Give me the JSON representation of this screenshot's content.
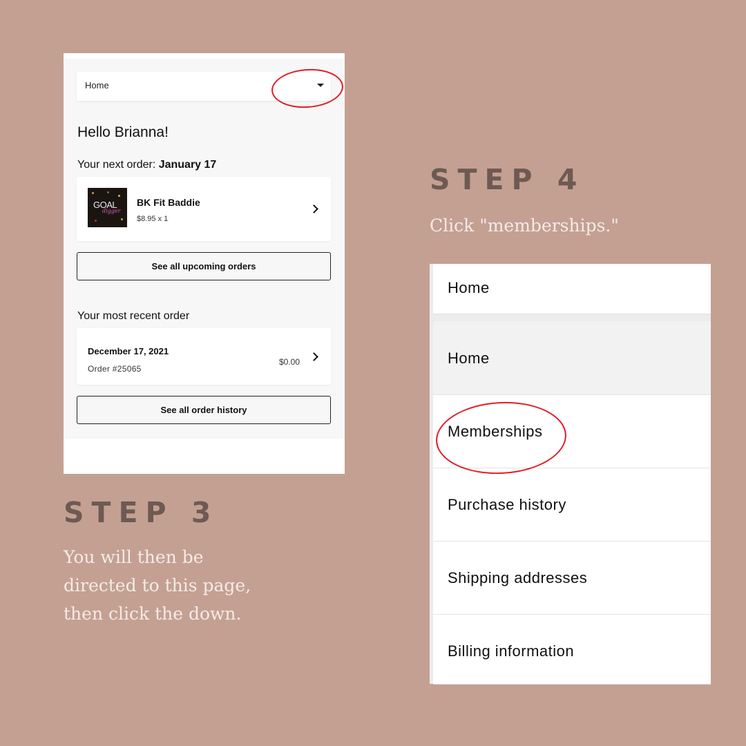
{
  "colors": {
    "background": "#c4a093",
    "heading": "#6e5a53",
    "description": "#f5ebe6",
    "highlight_circle": "#e21c24"
  },
  "step3": {
    "heading": "STEP 3",
    "description_lines": [
      "You will then be",
      "directed to this page,",
      "then click the down."
    ]
  },
  "step4": {
    "heading": "STEP 4",
    "description": "Click \"memberships.\""
  },
  "account_page": {
    "dropdown": {
      "value": "Home",
      "icon": "caret-down-icon"
    },
    "greeting": "Hello Brianna!",
    "next_order": {
      "prefix": "Your next order: ",
      "date": "January 17"
    },
    "upcoming_item": {
      "image_text": "GOAL",
      "image_subtext": "digger",
      "name": "BK Fit Baddie",
      "price": "$8.95 x 1"
    },
    "see_upcoming_label": "See all upcoming orders",
    "recent_title": "Your most recent order",
    "recent_order": {
      "date": "December 17, 2021",
      "number": "Order #25065",
      "total": "$0.00"
    },
    "see_history_label": "See all order history"
  },
  "menu": {
    "selected": "Home",
    "items": [
      {
        "label": "Home",
        "active": true
      },
      {
        "label": "Memberships",
        "active": false
      },
      {
        "label": "Purchase history",
        "active": false
      },
      {
        "label": "Shipping addresses",
        "active": false
      },
      {
        "label": "Billing information",
        "active": false
      }
    ]
  }
}
